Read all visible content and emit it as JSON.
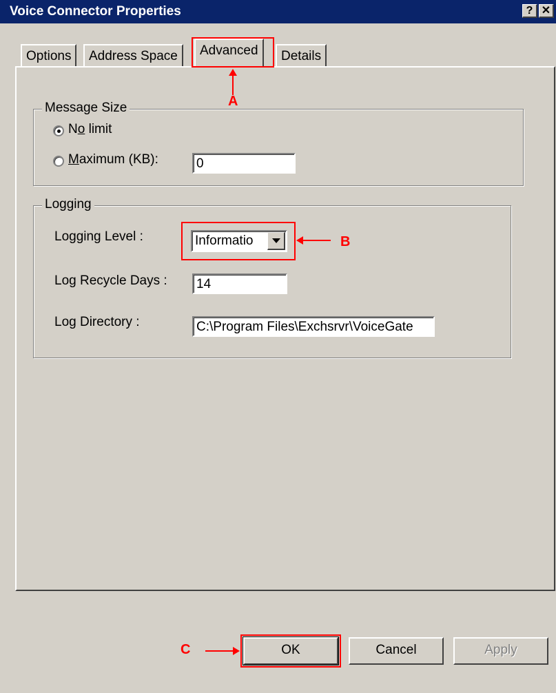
{
  "window": {
    "title": "Voice Connector Properties",
    "help_button": "?",
    "close_button": "✕"
  },
  "tabs": [
    {
      "label": "Options",
      "active": false
    },
    {
      "label": "Address Space",
      "active": false
    },
    {
      "label": "Advanced",
      "active": true
    },
    {
      "label": "Details",
      "active": false
    }
  ],
  "message_size": {
    "legend": "Message Size",
    "no_limit_label": "No limit",
    "no_limit_selected": true,
    "maximum_label": "Maximum (KB):",
    "maximum_selected": false,
    "maximum_value": "0"
  },
  "logging": {
    "legend": "Logging",
    "logging_level_label": "Logging Level :",
    "logging_level_value": "Informatio",
    "log_recycle_days_label": "Log Recycle Days :",
    "log_recycle_days_value": "14",
    "log_directory_label": "Log Directory :",
    "log_directory_value": "C:\\Program Files\\Exchsrvr\\VoiceGate"
  },
  "buttons": {
    "ok": "OK",
    "cancel": "Cancel",
    "apply": "Apply"
  },
  "annotations": {
    "a": "A",
    "b": "B",
    "c": "C",
    "color": "#ff0000"
  },
  "colors": {
    "title_bar": "#0a246a",
    "dialog_face": "#d4d0c8"
  }
}
